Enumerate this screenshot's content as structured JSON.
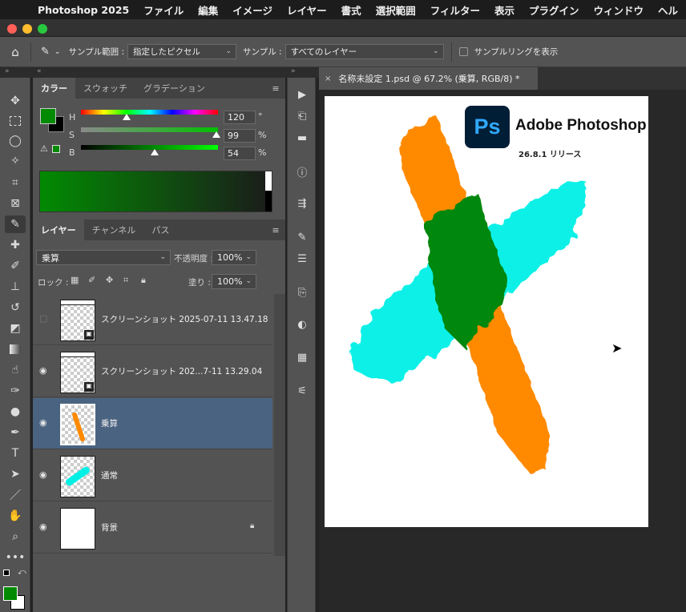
{
  "menubar": {
    "app": "Photoshop 2025",
    "items": [
      "ファイル",
      "編集",
      "イメージ",
      "レイヤー",
      "書式",
      "選択範囲",
      "フィルター",
      "表示",
      "プラグイン",
      "ウィンドウ",
      "ヘル"
    ]
  },
  "options": {
    "sample_size_label": "サンプル範囲 :",
    "sample_size_value": "指定したピクセル",
    "sample_label": "サンプル :",
    "sample_value": "すべてのレイヤー",
    "ring_label": "サンプルリングを表示"
  },
  "color_panel": {
    "tabs": [
      "カラー",
      "スウォッチ",
      "グラデーション"
    ],
    "h_label": "H",
    "s_label": "S",
    "b_label": "B",
    "h_value": "120",
    "s_value": "99",
    "b_value": "54",
    "h_unit": "°",
    "s_unit": "%",
    "b_unit": "%",
    "h_level": 0.333,
    "s_level": 0.99,
    "b_level": 0.54,
    "foreground": "#028a02",
    "background": "#000000"
  },
  "layers_panel": {
    "tabs": [
      "レイヤー",
      "チャンネル",
      "パス"
    ],
    "blend_mode": "乗算",
    "opacity_label": "不透明度 :",
    "opacity_value": "100%",
    "lock_label": "ロック :",
    "fill_label": "塗り :",
    "fill_value": "100%",
    "layers": [
      {
        "name": "スクリーンショット 2025-07-11 13.47.18",
        "visible": false
      },
      {
        "name": "スクリーンショット 202...7-11 13.29.04",
        "visible": true
      },
      {
        "name": "乗算",
        "visible": true
      },
      {
        "name": "通常",
        "visible": true
      },
      {
        "name": "背景",
        "visible": true
      }
    ]
  },
  "document": {
    "tab_title": "名称未設定 1.psd @ 67.2% (乗算, RGB/8) *",
    "logo_text": "Adobe Photoshop",
    "ps_mark": "Ps",
    "version": "26.8.1 リリース"
  },
  "colors": {
    "accent_layer": "#4a6380",
    "orange": "#ff8a00",
    "cyan": "#00f0e6",
    "overlap": "#00870a"
  }
}
